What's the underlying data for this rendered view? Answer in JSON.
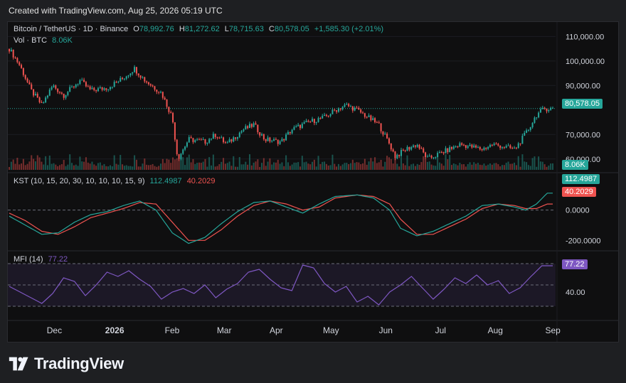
{
  "header": {
    "created": "Created with TradingView.com, Aug 25, 2026 05:19 UTC"
  },
  "legend": {
    "symbol": "Bitcoin / TetherUS · 1D · Binance",
    "o_label": "O",
    "o": "78,992.76",
    "h_label": "H",
    "h": "81,272.62",
    "l_label": "L",
    "l": "78,715.63",
    "c_label": "C",
    "c": "80,578.05",
    "change": "+1,585.30 (+2.01%)",
    "vol_label": "Vol · BTC",
    "vol": "8.06K",
    "kst_label": "KST (10, 15, 20, 30, 10, 10, 10, 15, 9)",
    "kst_value": "112.4987",
    "kst_signal": "40.2029",
    "mfi_label": "MFI (14)",
    "mfi_value": "77.22"
  },
  "price_axis": [
    "110,000.00",
    "100,000.00",
    "90,000.00",
    "70,000.00",
    "60,000.00"
  ],
  "kst_axis": [
    "0.0000",
    "-200.0000"
  ],
  "mfi_axis": [
    "40.00"
  ],
  "badges": {
    "price": "80,578.05",
    "vol": "8.06K",
    "kst": "112.4987",
    "signal": "40.2029",
    "mfi": "77.22"
  },
  "x_axis": [
    "Dec",
    "2026",
    "Feb",
    "Mar",
    "Apr",
    "May",
    "Jun",
    "Jul",
    "Aug",
    "Sep"
  ],
  "footer": {
    "brand": "TradingView"
  },
  "colors": {
    "up": "#26a69a",
    "down": "#ef5350",
    "kst": "#26a69a",
    "signal": "#ef5350",
    "mfi": "#7e57c2",
    "bg": "#0f0f10",
    "text": "#d1d4dc"
  },
  "chart_data": {
    "type": "candlestick",
    "price_ylim": [
      55000,
      113000
    ],
    "price_path": [
      [
        0,
        105000
      ],
      [
        0.02,
        98000
      ],
      [
        0.04,
        88000
      ],
      [
        0.06,
        82000
      ],
      [
        0.08,
        90000
      ],
      [
        0.1,
        86000
      ],
      [
        0.13,
        92000
      ],
      [
        0.15,
        88000
      ],
      [
        0.18,
        89000
      ],
      [
        0.21,
        93000
      ],
      [
        0.23,
        97000
      ],
      [
        0.25,
        92000
      ],
      [
        0.28,
        87000
      ],
      [
        0.3,
        77000
      ],
      [
        0.31,
        60000
      ],
      [
        0.33,
        68000
      ],
      [
        0.36,
        67000
      ],
      [
        0.38,
        70000
      ],
      [
        0.4,
        66000
      ],
      [
        0.43,
        72000
      ],
      [
        0.45,
        74000
      ],
      [
        0.47,
        68000
      ],
      [
        0.5,
        67000
      ],
      [
        0.52,
        72000
      ],
      [
        0.55,
        75000
      ],
      [
        0.58,
        77000
      ],
      [
        0.6,
        80000
      ],
      [
        0.62,
        82000
      ],
      [
        0.64,
        80000
      ],
      [
        0.66,
        77000
      ],
      [
        0.68,
        74000
      ],
      [
        0.7,
        66000
      ],
      [
        0.71,
        61000
      ],
      [
        0.73,
        64000
      ],
      [
        0.75,
        66000
      ],
      [
        0.77,
        60000
      ],
      [
        0.79,
        62000
      ],
      [
        0.81,
        64000
      ],
      [
        0.83,
        66000
      ],
      [
        0.85,
        65000
      ],
      [
        0.87,
        64000
      ],
      [
        0.89,
        66000
      ],
      [
        0.91,
        65000
      ],
      [
        0.93,
        64000
      ],
      [
        0.94,
        67000
      ],
      [
        0.955,
        72000
      ],
      [
        0.97,
        78000
      ],
      [
        0.985,
        80578
      ]
    ],
    "kst_ylim": [
      -250,
      200
    ],
    "kst_path": [
      [
        0,
        -40
      ],
      [
        0.03,
        -100
      ],
      [
        0.06,
        -160
      ],
      [
        0.09,
        -150
      ],
      [
        0.12,
        -80
      ],
      [
        0.15,
        -30
      ],
      [
        0.18,
        -10
      ],
      [
        0.21,
        30
      ],
      [
        0.24,
        60
      ],
      [
        0.27,
        0
      ],
      [
        0.3,
        -150
      ],
      [
        0.33,
        -220
      ],
      [
        0.36,
        -180
      ],
      [
        0.39,
        -90
      ],
      [
        0.42,
        -10
      ],
      [
        0.45,
        50
      ],
      [
        0.48,
        60
      ],
      [
        0.51,
        20
      ],
      [
        0.54,
        -20
      ],
      [
        0.57,
        40
      ],
      [
        0.6,
        90
      ],
      [
        0.64,
        100
      ],
      [
        0.67,
        80
      ],
      [
        0.7,
        0
      ],
      [
        0.72,
        -120
      ],
      [
        0.75,
        -170
      ],
      [
        0.78,
        -140
      ],
      [
        0.81,
        -90
      ],
      [
        0.84,
        -40
      ],
      [
        0.87,
        30
      ],
      [
        0.9,
        40
      ],
      [
        0.93,
        20
      ],
      [
        0.95,
        0
      ],
      [
        0.97,
        40
      ],
      [
        0.99,
        112
      ]
    ],
    "signal_path": [
      [
        0,
        -20
      ],
      [
        0.03,
        -70
      ],
      [
        0.06,
        -140
      ],
      [
        0.09,
        -160
      ],
      [
        0.12,
        -110
      ],
      [
        0.15,
        -50
      ],
      [
        0.18,
        -20
      ],
      [
        0.21,
        10
      ],
      [
        0.24,
        50
      ],
      [
        0.27,
        40
      ],
      [
        0.3,
        -80
      ],
      [
        0.33,
        -200
      ],
      [
        0.36,
        -200
      ],
      [
        0.39,
        -130
      ],
      [
        0.42,
        -40
      ],
      [
        0.45,
        30
      ],
      [
        0.48,
        60
      ],
      [
        0.51,
        40
      ],
      [
        0.54,
        0
      ],
      [
        0.57,
        20
      ],
      [
        0.6,
        80
      ],
      [
        0.64,
        100
      ],
      [
        0.67,
        90
      ],
      [
        0.7,
        40
      ],
      [
        0.72,
        -60
      ],
      [
        0.75,
        -160
      ],
      [
        0.78,
        -160
      ],
      [
        0.81,
        -110
      ],
      [
        0.84,
        -60
      ],
      [
        0.87,
        10
      ],
      [
        0.9,
        40
      ],
      [
        0.93,
        30
      ],
      [
        0.95,
        10
      ],
      [
        0.97,
        10
      ],
      [
        0.99,
        40
      ]
    ],
    "mfi_ylim": [
      10,
      90
    ],
    "mfi_path": [
      [
        0,
        48
      ],
      [
        0.02,
        40
      ],
      [
        0.04,
        32
      ],
      [
        0.06,
        24
      ],
      [
        0.08,
        38
      ],
      [
        0.1,
        60
      ],
      [
        0.12,
        55
      ],
      [
        0.14,
        35
      ],
      [
        0.16,
        50
      ],
      [
        0.18,
        68
      ],
      [
        0.2,
        62
      ],
      [
        0.22,
        70
      ],
      [
        0.24,
        58
      ],
      [
        0.26,
        48
      ],
      [
        0.28,
        30
      ],
      [
        0.3,
        40
      ],
      [
        0.32,
        45
      ],
      [
        0.34,
        38
      ],
      [
        0.36,
        50
      ],
      [
        0.38,
        32
      ],
      [
        0.4,
        44
      ],
      [
        0.42,
        52
      ],
      [
        0.44,
        68
      ],
      [
        0.46,
        72
      ],
      [
        0.48,
        58
      ],
      [
        0.5,
        46
      ],
      [
        0.52,
        42
      ],
      [
        0.54,
        78
      ],
      [
        0.56,
        74
      ],
      [
        0.58,
        52
      ],
      [
        0.6,
        40
      ],
      [
        0.62,
        48
      ],
      [
        0.64,
        26
      ],
      [
        0.66,
        34
      ],
      [
        0.68,
        22
      ],
      [
        0.7,
        40
      ],
      [
        0.72,
        50
      ],
      [
        0.74,
        62
      ],
      [
        0.76,
        46
      ],
      [
        0.78,
        30
      ],
      [
        0.8,
        44
      ],
      [
        0.82,
        60
      ],
      [
        0.84,
        52
      ],
      [
        0.86,
        64
      ],
      [
        0.88,
        50
      ],
      [
        0.9,
        56
      ],
      [
        0.92,
        38
      ],
      [
        0.94,
        46
      ],
      [
        0.96,
        62
      ],
      [
        0.98,
        77
      ]
    ]
  }
}
